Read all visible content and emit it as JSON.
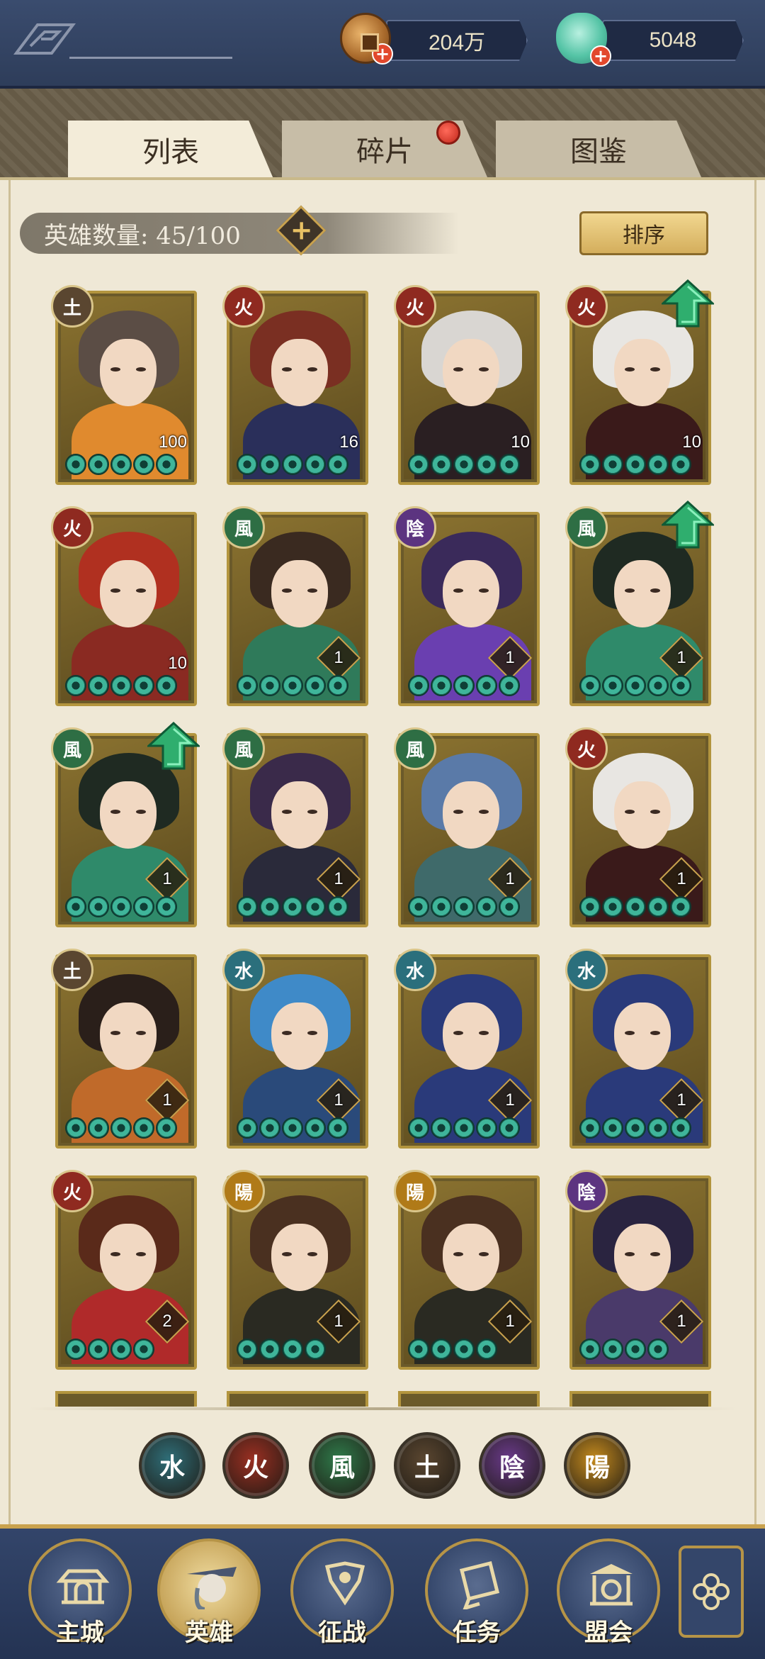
{
  "currencies": [
    {
      "name": "copper-coin",
      "value": "204万",
      "icon": "coin-icon"
    },
    {
      "name": "jade",
      "value": "5048",
      "icon": "jade-icon"
    }
  ],
  "tabs": [
    {
      "label": "列表",
      "active": true
    },
    {
      "label": "碎片",
      "active": false,
      "has_notification": true
    },
    {
      "label": "图鉴",
      "active": false
    }
  ],
  "hero_count": {
    "label": "英雄数量: 45/100"
  },
  "sort_button": {
    "label": "排序"
  },
  "heroes": [
    {
      "element": "土",
      "level": "100",
      "stars": 5,
      "upgrade": false
    },
    {
      "element": "火",
      "level": "16",
      "stars": 5,
      "upgrade": false
    },
    {
      "element": "火",
      "level": "10",
      "stars": 5,
      "upgrade": false
    },
    {
      "element": "火",
      "level": "10",
      "stars": 5,
      "upgrade": true
    },
    {
      "element": "火",
      "level": "10",
      "stars": 5,
      "upgrade": false
    },
    {
      "element": "風",
      "level": "1",
      "stars": 5,
      "upgrade": false
    },
    {
      "element": "陰",
      "level": "1",
      "stars": 5,
      "upgrade": false
    },
    {
      "element": "風",
      "level": "1",
      "stars": 5,
      "upgrade": true
    },
    {
      "element": "風",
      "level": "1",
      "stars": 5,
      "upgrade": true
    },
    {
      "element": "風",
      "level": "1",
      "stars": 5,
      "upgrade": false
    },
    {
      "element": "風",
      "level": "1",
      "stars": 5,
      "upgrade": false
    },
    {
      "element": "火",
      "level": "1",
      "stars": 5,
      "upgrade": false
    },
    {
      "element": "土",
      "level": "1",
      "stars": 5,
      "upgrade": false
    },
    {
      "element": "水",
      "level": "1",
      "stars": 5,
      "upgrade": false
    },
    {
      "element": "水",
      "level": "1",
      "stars": 5,
      "upgrade": false
    },
    {
      "element": "水",
      "level": "1",
      "stars": 5,
      "upgrade": false
    },
    {
      "element": "火",
      "level": "2",
      "stars": 4,
      "upgrade": false
    },
    {
      "element": "陽",
      "level": "1",
      "stars": 4,
      "upgrade": false
    },
    {
      "element": "陽",
      "level": "1",
      "stars": 4,
      "upgrade": false
    },
    {
      "element": "陰",
      "level": "1",
      "stars": 4,
      "upgrade": false
    }
  ],
  "element_filters": [
    {
      "element": "水",
      "color": "#2f6e78"
    },
    {
      "element": "火",
      "color": "#9a2f22"
    },
    {
      "element": "風",
      "color": "#2f7a4a"
    },
    {
      "element": "土",
      "color": "#5a4630"
    },
    {
      "element": "陰",
      "color": "#6a3a8a"
    },
    {
      "element": "陽",
      "color": "#c48a1e"
    }
  ],
  "element_colors": {
    "水": "#2b6f7c",
    "火": "#8f2a20",
    "風": "#2e6e44",
    "土": "#5a4630",
    "陰": "#5c3480",
    "陽": "#b07a18"
  },
  "nav": [
    {
      "label": "主城",
      "icon": "city-gate-icon",
      "active": false
    },
    {
      "label": "英雄",
      "icon": "hero-portrait-icon",
      "active": true
    },
    {
      "label": "征战",
      "icon": "battle-icon",
      "active": false
    },
    {
      "label": "任务",
      "icon": "quest-scroll-icon",
      "active": false
    },
    {
      "label": "盟会",
      "icon": "alliance-icon",
      "active": false
    }
  ],
  "nav_menu_icon": "menu-flower-icon"
}
